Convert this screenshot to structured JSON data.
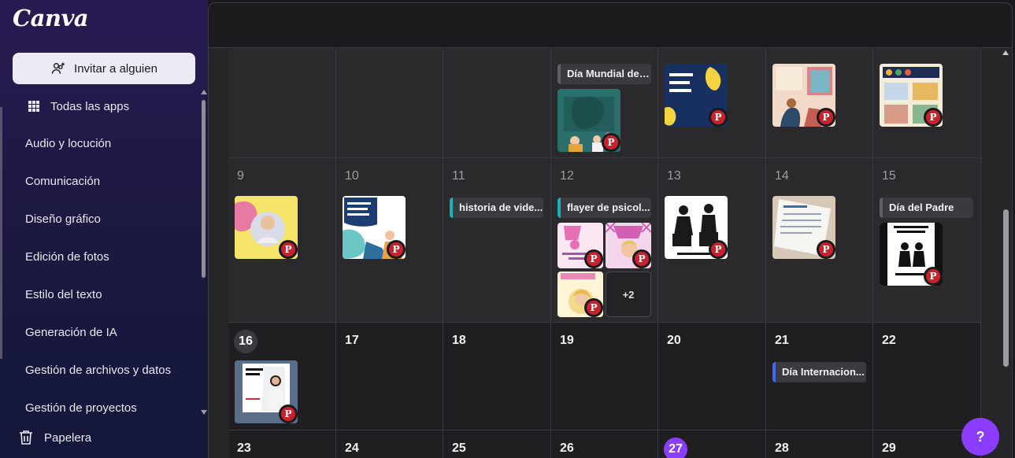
{
  "brand": {
    "logo": "Canva",
    "accent": "#8b3dff"
  },
  "sidebar": {
    "invite_label": "Invitar a alguien",
    "all_apps_label": "Todas las apps",
    "items": [
      {
        "label": "Audio y locución"
      },
      {
        "label": "Comunicación"
      },
      {
        "label": "Diseño gráfico"
      },
      {
        "label": "Edición de fotos"
      },
      {
        "label": "Estilo del texto"
      },
      {
        "label": "Generación de IA"
      },
      {
        "label": "Gestión de archivos y datos"
      },
      {
        "label": "Gestión de proyectos"
      }
    ],
    "trash_label": "Papelera"
  },
  "calendar": {
    "days": {
      "d9": "9",
      "d10": "10",
      "d11": "11",
      "d12": "12",
      "d13": "13",
      "d14": "14",
      "d15": "15",
      "d16": "16",
      "d17": "17",
      "d18": "18",
      "d19": "19",
      "d20": "20",
      "d21": "21",
      "d22": "22",
      "d23": "23",
      "d24": "24",
      "d25": "25",
      "d26": "26",
      "d27": "27",
      "d28": "28",
      "d29": "29"
    },
    "events": {
      "dia_mundial": "Día Mundial del ...",
      "historia_video": "historia de vide...",
      "flayer_psicol": "flayer de psicol...",
      "dia_padre": "Día del Padre",
      "dia_internacional": "Día Internacion..."
    },
    "more_count": "+2",
    "event_colors": {
      "grey": "#5f5f66",
      "teal": "#17b3b8",
      "blue": "#3b6cf0"
    }
  },
  "help_label": "?"
}
